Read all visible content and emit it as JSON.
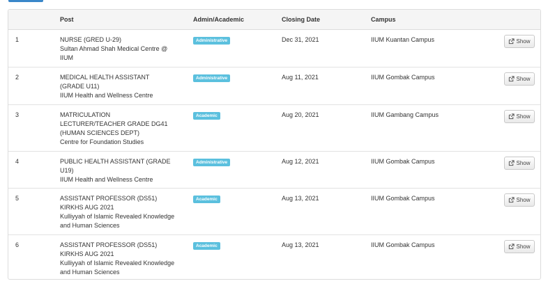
{
  "table": {
    "headers": {
      "post": "Post",
      "type": "Admin/Academic",
      "closing_date": "Closing Date",
      "campus": "Campus"
    },
    "rows": [
      {
        "num": "1",
        "post_lines": [
          "NURSE (GRED U-29)",
          "Sultan Ahmad Shah Medical Centre @",
          "IIUM"
        ],
        "type": "Administrative",
        "date": "Dec 31, 2021",
        "campus": "IIUM Kuantan Campus",
        "action": "Show"
      },
      {
        "num": "2",
        "post_lines": [
          "MEDICAL HEALTH ASSISTANT",
          "(GRADE U11)",
          "IIUM Health and Wellness Centre"
        ],
        "type": "Administrative",
        "date": "Aug 11, 2021",
        "campus": "IIUM Gombak Campus",
        "action": "Show"
      },
      {
        "num": "3",
        "post_lines": [
          "MATRICULATION",
          "LECTURER/TEACHER GRADE DG41",
          "(HUMAN SCIENCES DEPT)",
          "Centre for Foundation Studies"
        ],
        "type": "Academic",
        "date": "Aug 20, 2021",
        "campus": "IIUM Gambang Campus",
        "action": "Show"
      },
      {
        "num": "4",
        "post_lines": [
          "PUBLIC HEALTH ASSISTANT (GRADE",
          "U19)",
          "IIUM Health and Wellness Centre"
        ],
        "type": "Administrative",
        "date": "Aug 12, 2021",
        "campus": "IIUM Gombak Campus",
        "action": "Show"
      },
      {
        "num": "5",
        "post_lines": [
          "ASSISTANT PROFESSOR (DS51)",
          "KIRKHS AUG 2021",
          "Kulliyyah of Islamic Revealed Knowledge",
          "and Human Sciences"
        ],
        "type": "Academic",
        "date": "Aug 13, 2021",
        "campus": "IIUM Gombak Campus",
        "action": "Show"
      },
      {
        "num": "6",
        "post_lines": [
          "ASSISTANT PROFESSOR (DS51)",
          "KIRKHS AUG 2021",
          "Kulliyyah of Islamic Revealed Knowledge",
          "and Human Sciences"
        ],
        "type": "Academic",
        "date": "Aug 13, 2021",
        "campus": "IIUM Gombak Campus",
        "action": "Show"
      }
    ]
  }
}
